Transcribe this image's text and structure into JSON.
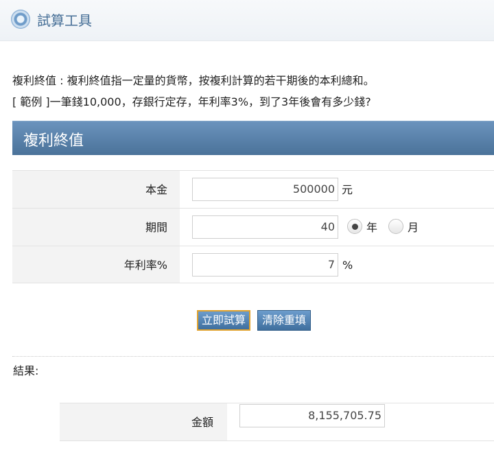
{
  "app": {
    "title": "試算工具",
    "icon": "compass-ring-icon"
  },
  "intro": {
    "line1": "複利終值 : 複利終值指一定量的貨幣，按複利計算的若干期後的本利總和。",
    "line2": "[ 範例 ]一筆錢10,000，存銀行定存，年利率3%，到了3年後會有多少錢?"
  },
  "section": {
    "title": "複利終值"
  },
  "form": {
    "principal": {
      "label": "本金",
      "value": "500000",
      "unit": "元"
    },
    "period": {
      "label": "期間",
      "value": "40",
      "options": [
        {
          "label": "年",
          "checked": true
        },
        {
          "label": "月",
          "checked": false
        }
      ]
    },
    "rate": {
      "label": "年利率%",
      "value": "7",
      "unit": "%"
    }
  },
  "buttons": {
    "calculate": "立即試算",
    "reset": "清除重填"
  },
  "result": {
    "heading": "結果:",
    "amount_label": "金額",
    "amount_value": "8,155,705.75"
  },
  "colors": {
    "header_bg": "#5a82ab",
    "title_text": "#456e96",
    "button_bg": "#4f80b0",
    "button_focus_border": "#e0a12b"
  }
}
